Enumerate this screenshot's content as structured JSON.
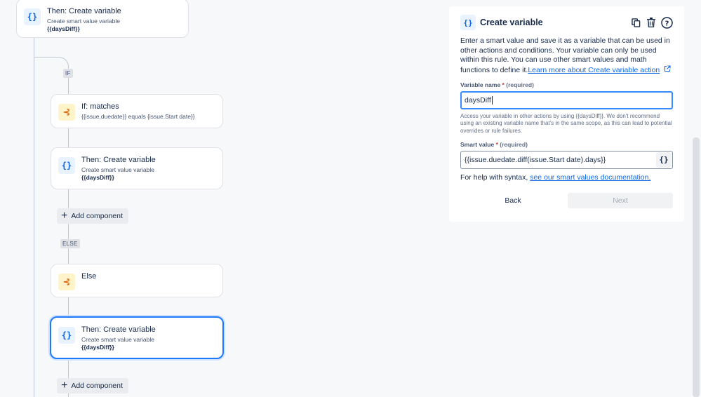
{
  "flow": {
    "top_card": {
      "title": "Then: Create variable",
      "subtitle": "Create smart value variable",
      "var": "{{daysDiff}}",
      "icon": "curly-braces-icon"
    },
    "if_tag": "IF",
    "if_card": {
      "title": "If: matches",
      "subtitle": "{{issue.duedate}} equals {issue.Start date}}",
      "icon": "branch-icon"
    },
    "then_card_1": {
      "title": "Then: Create variable",
      "subtitle": "Create smart value variable",
      "var": "{{daysDiff}}",
      "icon": "curly-braces-icon"
    },
    "add_component_1": "Add component",
    "else_tag": "ELSE",
    "else_card": {
      "title": "Else",
      "icon": "branch-icon"
    },
    "then_card_2": {
      "title": "Then: Create variable",
      "subtitle": "Create smart value variable",
      "var": "{{daysDiff}}",
      "icon": "curly-braces-icon"
    },
    "add_component_2": "Add component",
    "icon_glyph": "{}",
    "branch_glyph": "⊰"
  },
  "panel": {
    "title": "Create variable",
    "description": "Enter a smart value and save it as a variable that can be used in other actions and conditions. Your variable can only be used within this rule. You can use other smart values and math functions to define it.",
    "learn_more": "Learn more about Create variable action",
    "variable_name_label": "Variable name",
    "required_text": "(required)",
    "variable_name_value": "daysDiff",
    "variable_help": "Access your variable in other actions by using {{daysDiff}}. We don't recommend using an existing variable name that's in the same scope, as this can lead to potential overrides or rule failures.",
    "smart_value_label": "Smart value",
    "smart_value": "{{issue.duedate.diff(issue.Start date).days}}",
    "syntax_help_prefix": "For help with syntax,",
    "syntax_help_link": "see our smart values documentation.",
    "back_label": "Back",
    "next_label": "Next"
  },
  "colors": {
    "accent": "#0c66e4",
    "selected_border": "#1d7afc",
    "orange": "#e56910"
  }
}
